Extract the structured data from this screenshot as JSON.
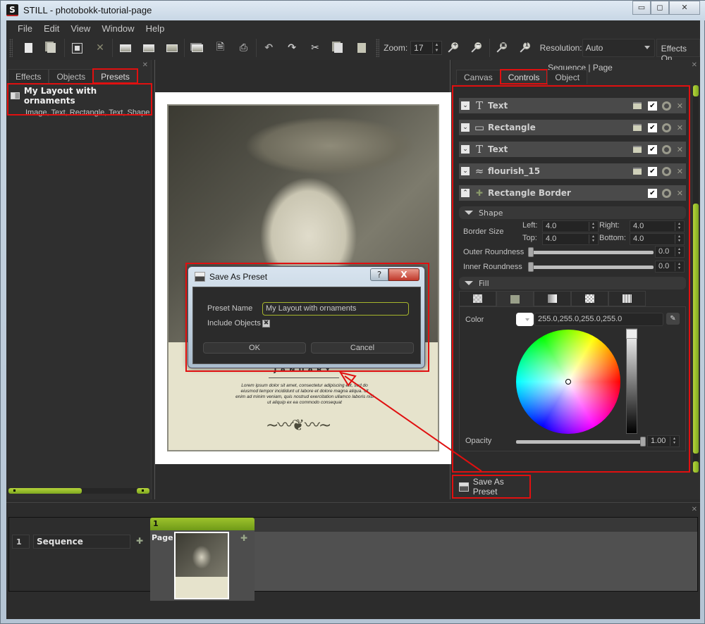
{
  "window": {
    "app_icon_letter": "S",
    "title": "STILL - photobokk-tutorial-page",
    "minimize": "▭",
    "maximize": "◻",
    "close": "✕"
  },
  "menu": [
    "File",
    "Edit",
    "View",
    "Window",
    "Help"
  ],
  "toolbar": {
    "buttons": [
      {
        "name": "new-document",
        "icon": "new-document-icon"
      },
      {
        "name": "duplicate",
        "icon": "duplicate-icon"
      },
      {
        "name": "save",
        "icon": "save-icon"
      },
      {
        "name": "close",
        "icon": "close-icon"
      },
      {
        "name": "import-image",
        "icon": "import-image-icon"
      },
      {
        "name": "export-image",
        "icon": "export-image-icon"
      },
      {
        "name": "open-folder",
        "icon": "folder-icon"
      },
      {
        "name": "batch",
        "icon": "batch-icon"
      },
      {
        "name": "export-pdf",
        "icon": "pdf-icon"
      },
      {
        "name": "print",
        "icon": "print-icon"
      },
      {
        "name": "undo",
        "icon": "undo-icon"
      },
      {
        "name": "redo",
        "icon": "redo-icon"
      },
      {
        "name": "cut",
        "icon": "cut-icon"
      },
      {
        "name": "copy",
        "icon": "copy-icon"
      },
      {
        "name": "paste",
        "icon": "paste-icon"
      }
    ],
    "zoom_label": "Zoom:",
    "zoom_value": "17",
    "resolution_label": "Resolution:",
    "resolution_value": "Auto",
    "effects_label": "Effects On"
  },
  "left_panel": {
    "tabs": [
      "Effects",
      "Objects",
      "Presets"
    ],
    "active_tab": "Presets",
    "presets": [
      {
        "title": "My Layout with ornaments",
        "subtitle": "Image, Text, Rectangle, Text, Shape"
      }
    ]
  },
  "canvas": {
    "page_heading": "JANUARY",
    "lorem": "Lorem ipsum dolor sit amet, consectetur adipiscing elit, sed do eiusmod tempor incididunt ut labore et dolore magna aliqua. Ut enim ad minim veniam, quis nostrud exercitation ullamco laboris nisi ut aliquip ex ea commodo consequat",
    "ornament": "❦"
  },
  "right_panel": {
    "breadcrumb": "Sequence | Page",
    "tabs": [
      "Canvas",
      "Controls",
      "Object"
    ],
    "active_tab": "Controls",
    "objects": [
      {
        "name": "Text",
        "icon": "T",
        "locked": false,
        "visible": true
      },
      {
        "name": "Rectangle",
        "icon": "▭",
        "locked": false,
        "visible": true
      },
      {
        "name": "Text",
        "icon": "T",
        "locked": false,
        "visible": true
      },
      {
        "name": "flourish_15",
        "icon": "≈",
        "locked": false,
        "visible": true
      },
      {
        "name": "Rectangle Border",
        "icon": "✚",
        "visible": true,
        "expanded": true
      }
    ],
    "shape": {
      "section_label": "Shape",
      "border_size_label": "Border Size",
      "left_label": "Left:",
      "left_value": "4.0",
      "right_label": "Right:",
      "right_value": "4.0",
      "top_label": "Top:",
      "top_value": "4.0",
      "bottom_label": "Bottom:",
      "bottom_value": "4.0",
      "outer_roundness_label": "Outer Roundness",
      "outer_roundness_value": "0.0",
      "inner_roundness_label": "Inner Roundness",
      "inner_roundness_value": "0.0"
    },
    "fill": {
      "section_label": "Fill",
      "tabs": [
        "none",
        "solid",
        "gradient",
        "transparent",
        "pattern"
      ],
      "active_tab": "solid",
      "color_label": "Color",
      "color_value": "255.0,255.0,255.0,255.0",
      "swatch_color": "#ffffff",
      "opacity_label": "Opacity",
      "opacity_value": "1.00"
    },
    "save_preset_label": "Save As Preset"
  },
  "dialog": {
    "title": "Save As Preset",
    "help": "?",
    "close": "X",
    "preset_name_label": "Preset Name",
    "preset_name_value": "My Layout with ornaments",
    "include_objects_label": "Include Objects",
    "include_objects_checked": true,
    "ok_label": "OK",
    "cancel_label": "Cancel"
  },
  "timeline": {
    "sequence_number": "1",
    "sequence_name": "Sequence",
    "page_number": "1",
    "page_label": "Page"
  },
  "colors": {
    "accent_green": "#8fb820",
    "highlight_red": "#e01010",
    "panel_bg": "#2c2c2c"
  }
}
